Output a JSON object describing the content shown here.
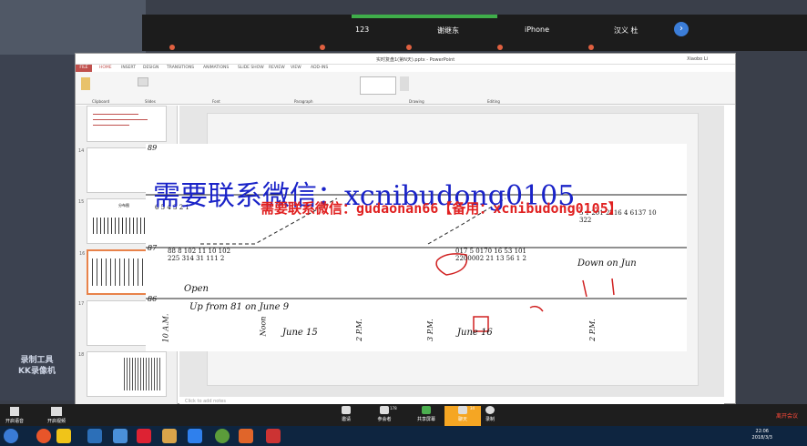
{
  "top_tabs": [
    "123",
    "谢继东",
    "iPhone",
    "汉义 杜"
  ],
  "ppt": {
    "title": "实时复盘1(第N天).pptx - PowerPoint",
    "user": "Xiaobo Li",
    "file_tab": "FILE",
    "tabs": [
      "HOME",
      "INSERT",
      "DESIGN",
      "TRANSITIONS",
      "ANIMATIONS",
      "SLIDE SHOW",
      "REVIEW",
      "VIEW",
      "ADD-INS"
    ],
    "groups": [
      "Clipboard",
      "Slides",
      "Font",
      "Paragraph",
      "Drawing",
      "Editing"
    ],
    "notes_placeholder": "Click to add notes",
    "thumb_numbers": [
      "14",
      "15",
      "16",
      "17",
      "18",
      "19"
    ],
    "thumb_title": "分布图"
  },
  "watermark": {
    "line1": "需要联系微信：xcnibudong0105",
    "line2": "需要联系微信：gudaonan66【备用：xcnibudong0105】"
  },
  "chart": {
    "price_labels": [
      "89",
      "87",
      "86"
    ],
    "annotations": [
      "Open",
      "Up from 81 on June 9",
      "June 15",
      "June 16",
      "Down on Jun",
      "Noon",
      "10 A.M.",
      "2 P.M.",
      "3 P.M."
    ]
  },
  "recorder": {
    "line1": "录制工具",
    "line2": "KK录像机"
  },
  "meeting": {
    "left_buttons": [
      "开启语音",
      "开启视频"
    ],
    "buttons": [
      "邀请",
      "参会者",
      "共享屏幕",
      "聊天",
      "录制"
    ],
    "participants_count": "178",
    "chat_count": "34",
    "leave": "离开会议"
  },
  "taskbar": {
    "time": "22:06",
    "date": "2018/3/3"
  }
}
